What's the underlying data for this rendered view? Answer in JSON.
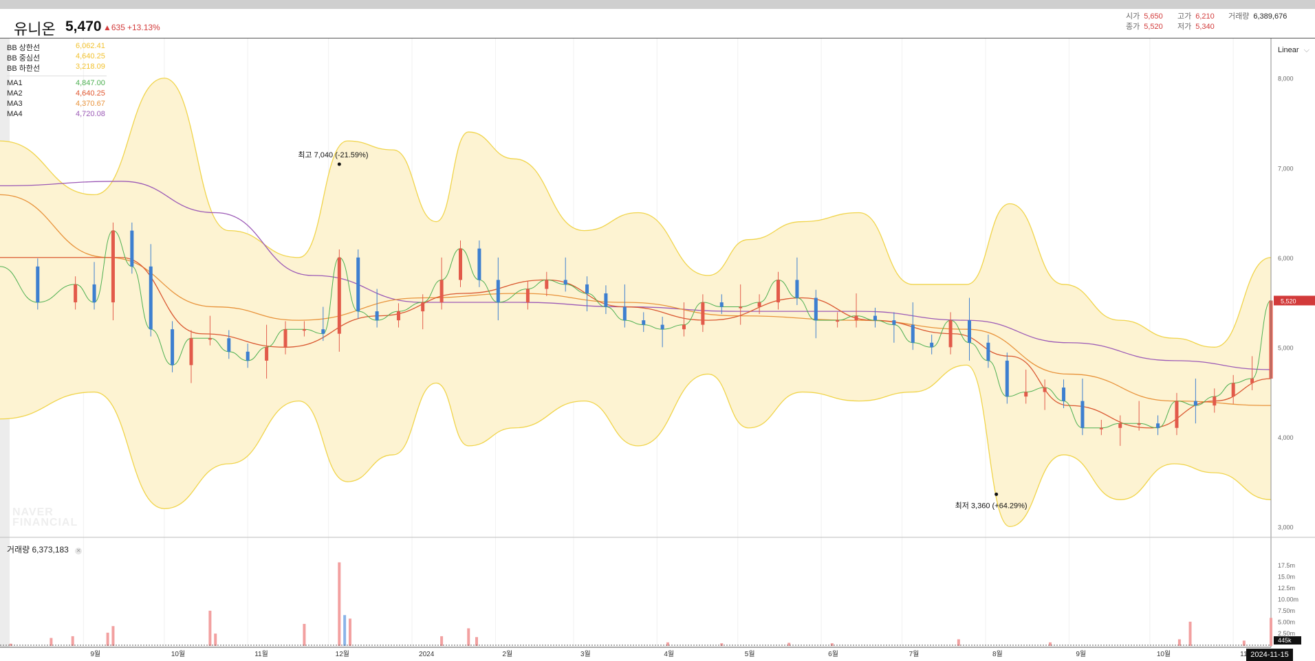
{
  "header": {
    "name": "유니온",
    "price": "5,470",
    "change": "▲635",
    "change_pct": "+13.13%",
    "open_label": "시가",
    "open": "5,650",
    "high_label": "고가",
    "high": "6,210",
    "volume_label": "거래량",
    "volume": "6,389,676",
    "close_label": "종가",
    "close": "5,520",
    "low_label": "저가",
    "low": "5,340"
  },
  "legend": {
    "bb": [
      {
        "label": "BB 상한선",
        "value": "6,062.41",
        "color": "#f2c12e"
      },
      {
        "label": "BB 중심선",
        "value": "4,640.25",
        "color": "#f2c12e"
      },
      {
        "label": "BB 하한선",
        "value": "3,218.09",
        "color": "#f2c12e"
      }
    ],
    "ma": [
      {
        "label": "MA1",
        "value": "4,847.00",
        "color": "#4caf50"
      },
      {
        "label": "MA2",
        "value": "4,640.25",
        "color": "#e0552e"
      },
      {
        "label": "MA3",
        "value": "4,370.67",
        "color": "#e8923a"
      },
      {
        "label": "MA4",
        "value": "4,720.08",
        "color": "#9b59b6"
      }
    ]
  },
  "scale_mode": "Linear",
  "volume_panel": {
    "label": "거래량",
    "value": "6,373,183"
  },
  "current_price_tag": "5,520",
  "current_volume_tag": "445k",
  "current_date_tag": "2024-11-15",
  "watermark": [
    "NAVER",
    "FINANCIAL"
  ],
  "colors": {
    "up": "#e25a4a",
    "down": "#3d7fd0",
    "band_fill": "#fdf3d2",
    "band_line": "#f0d44a",
    "ma1": "#4caf50",
    "ma2": "#d9562f",
    "ma3": "#e8923a",
    "ma4": "#9b59b6"
  },
  "chart_data": {
    "type": "candlestick",
    "y_axis": {
      "ticks": [
        "8,000",
        "7,000",
        "6,000",
        "5,000",
        "4,000",
        "3,000"
      ],
      "tick_values": [
        8000,
        7000,
        6000,
        5000,
        4000,
        3000
      ],
      "range": [
        2880,
        8450
      ]
    },
    "volume_axis": {
      "ticks": [
        "17.5m",
        "15.0m",
        "12.5m",
        "10.00m",
        "7.50m",
        "5.00m",
        "2.50m"
      ]
    },
    "x_labels": [
      "9월",
      "10월",
      "11월",
      "12월",
      "2024",
      "2월",
      "3월",
      "4월",
      "5월",
      "6월",
      "7월",
      "8월",
      "9월",
      "10월",
      "11월"
    ],
    "x_range": [
      "2023-08-01",
      "2024-11-15"
    ],
    "annotations": [
      {
        "text": "최고 7,040 (-21.59%)",
        "value": 7040,
        "date": "2023-12-05"
      },
      {
        "text": "최저 3,360 (+64.29%)",
        "value": 3360,
        "date": "2024-08-05"
      }
    ],
    "series": {
      "close": [
        [
          "2023-08-01",
          5900
        ],
        [
          "2023-08-15",
          5500
        ],
        [
          "2023-08-29",
          5700
        ],
        [
          "2023-09-05",
          5500
        ],
        [
          "2023-09-12",
          6300
        ],
        [
          "2023-09-19",
          5900
        ],
        [
          "2023-09-26",
          5200
        ],
        [
          "2023-10-04",
          4800
        ],
        [
          "2023-10-11",
          5100
        ],
        [
          "2023-10-18",
          5100
        ],
        [
          "2023-10-25",
          4950
        ],
        [
          "2023-11-01",
          4850
        ],
        [
          "2023-11-08",
          5000
        ],
        [
          "2023-11-15",
          5200
        ],
        [
          "2023-11-22",
          5200
        ],
        [
          "2023-11-29",
          5150
        ],
        [
          "2023-12-05",
          6000
        ],
        [
          "2023-12-12",
          5400
        ],
        [
          "2023-12-19",
          5300
        ],
        [
          "2023-12-27",
          5400
        ],
        [
          "2024-01-05",
          5500
        ],
        [
          "2024-01-12",
          5750
        ],
        [
          "2024-01-19",
          6100
        ],
        [
          "2024-01-26",
          5750
        ],
        [
          "2024-02-02",
          5500
        ],
        [
          "2024-02-13",
          5650
        ],
        [
          "2024-02-20",
          5750
        ],
        [
          "2024-02-27",
          5700
        ],
        [
          "2024-03-06",
          5600
        ],
        [
          "2024-03-13",
          5450
        ],
        [
          "2024-03-20",
          5300
        ],
        [
          "2024-03-27",
          5250
        ],
        [
          "2024-04-03",
          5200
        ],
        [
          "2024-04-11",
          5250
        ],
        [
          "2024-04-18",
          5500
        ],
        [
          "2024-04-25",
          5450
        ],
        [
          "2024-05-02",
          5450
        ],
        [
          "2024-05-09",
          5500
        ],
        [
          "2024-05-16",
          5750
        ],
        [
          "2024-05-23",
          5550
        ],
        [
          "2024-05-30",
          5300
        ],
        [
          "2024-06-07",
          5300
        ],
        [
          "2024-06-14",
          5350
        ],
        [
          "2024-06-21",
          5300
        ],
        [
          "2024-06-28",
          5250
        ],
        [
          "2024-07-05",
          5050
        ],
        [
          "2024-07-12",
          5000
        ],
        [
          "2024-07-19",
          5300
        ],
        [
          "2024-07-26",
          5050
        ],
        [
          "2024-08-02",
          4850
        ],
        [
          "2024-08-09",
          4450
        ],
        [
          "2024-08-16",
          4500
        ],
        [
          "2024-08-23",
          4550
        ],
        [
          "2024-08-30",
          4400
        ],
        [
          "2024-09-06",
          4100
        ],
        [
          "2024-09-13",
          4100
        ],
        [
          "2024-09-20",
          4150
        ],
        [
          "2024-09-27",
          4150
        ],
        [
          "2024-10-04",
          4100
        ],
        [
          "2024-10-11",
          4400
        ],
        [
          "2024-10-18",
          4350
        ],
        [
          "2024-10-25",
          4450
        ],
        [
          "2024-11-01",
          4600
        ],
        [
          "2024-11-08",
          4650
        ],
        [
          "2024-11-15",
          5520
        ]
      ],
      "bb_upper": [
        [
          "2023-08-01",
          7300
        ],
        [
          "2023-09-05",
          6700
        ],
        [
          "2023-10-01",
          8000
        ],
        [
          "2023-10-25",
          6300
        ],
        [
          "2023-11-20",
          6000
        ],
        [
          "2023-12-08",
          7300
        ],
        [
          "2023-12-25",
          7200
        ],
        [
          "2024-01-10",
          6400
        ],
        [
          "2024-01-22",
          7400
        ],
        [
          "2024-02-08",
          7100
        ],
        [
          "2024-03-05",
          6300
        ],
        [
          "2024-03-25",
          6500
        ],
        [
          "2024-04-20",
          5800
        ],
        [
          "2024-05-05",
          6200
        ],
        [
          "2024-05-25",
          6400
        ],
        [
          "2024-06-15",
          6500
        ],
        [
          "2024-07-05",
          5700
        ],
        [
          "2024-07-25",
          5700
        ],
        [
          "2024-08-10",
          6600
        ],
        [
          "2024-08-30",
          5700
        ],
        [
          "2024-09-20",
          5300
        ],
        [
          "2024-10-10",
          5100
        ],
        [
          "2024-10-25",
          5000
        ],
        [
          "2024-11-15",
          6000
        ]
      ],
      "bb_lower": [
        [
          "2023-08-01",
          4200
        ],
        [
          "2023-09-05",
          4500
        ],
        [
          "2023-10-01",
          3200
        ],
        [
          "2023-10-25",
          3700
        ],
        [
          "2023-11-20",
          4400
        ],
        [
          "2023-12-08",
          3500
        ],
        [
          "2023-12-25",
          3800
        ],
        [
          "2024-01-10",
          4600
        ],
        [
          "2024-01-22",
          3900
        ],
        [
          "2024-02-08",
          4100
        ],
        [
          "2024-03-05",
          4400
        ],
        [
          "2024-03-25",
          3900
        ],
        [
          "2024-04-20",
          4700
        ],
        [
          "2024-05-05",
          4100
        ],
        [
          "2024-05-25",
          4500
        ],
        [
          "2024-06-15",
          4400
        ],
        [
          "2024-07-05",
          4500
        ],
        [
          "2024-07-25",
          4800
        ],
        [
          "2024-08-10",
          3000
        ],
        [
          "2024-08-30",
          3800
        ],
        [
          "2024-09-20",
          3300
        ],
        [
          "2024-10-10",
          3700
        ],
        [
          "2024-10-25",
          3600
        ],
        [
          "2024-11-15",
          3300
        ]
      ],
      "ma4": [
        [
          "2023-08-01",
          6800
        ],
        [
          "2023-09-15",
          6850
        ],
        [
          "2023-10-20",
          6500
        ],
        [
          "2023-11-25",
          5800
        ],
        [
          "2024-01-05",
          5500
        ],
        [
          "2024-02-10",
          5500
        ],
        [
          "2024-03-20",
          5450
        ],
        [
          "2024-05-01",
          5400
        ],
        [
          "2024-06-15",
          5400
        ],
        [
          "2024-07-25",
          5300
        ],
        [
          "2024-09-01",
          5050
        ],
        [
          "2024-10-10",
          4850
        ],
        [
          "2024-11-15",
          4750
        ]
      ],
      "ma3": [
        [
          "2023-08-01",
          6700
        ],
        [
          "2023-09-10",
          6000
        ],
        [
          "2023-10-20",
          5450
        ],
        [
          "2023-11-20",
          5300
        ],
        [
          "2024-01-05",
          5550
        ],
        [
          "2024-02-10",
          5600
        ],
        [
          "2024-03-20",
          5500
        ],
        [
          "2024-05-01",
          5350
        ],
        [
          "2024-06-15",
          5300
        ],
        [
          "2024-07-25",
          5200
        ],
        [
          "2024-09-01",
          4700
        ],
        [
          "2024-10-10",
          4400
        ],
        [
          "2024-11-15",
          4350
        ]
      ],
      "ma2": [
        [
          "2023-08-01",
          6000
        ],
        [
          "2023-09-15",
          6000
        ],
        [
          "2023-10-15",
          5150
        ],
        [
          "2023-11-15",
          5000
        ],
        [
          "2023-12-20",
          5350
        ],
        [
          "2024-01-20",
          5600
        ],
        [
          "2024-02-20",
          5750
        ],
        [
          "2024-03-20",
          5450
        ],
        [
          "2024-04-20",
          5300
        ],
        [
          "2024-05-25",
          5550
        ],
        [
          "2024-06-20",
          5300
        ],
        [
          "2024-07-20",
          5150
        ],
        [
          "2024-08-10",
          4900
        ],
        [
          "2024-09-01",
          4350
        ],
        [
          "2024-10-01",
          4100
        ],
        [
          "2024-10-25",
          4400
        ],
        [
          "2024-11-15",
          4650
        ]
      ]
    },
    "volume_m": [
      [
        "2023-08-05",
        0.5
      ],
      [
        "2023-08-20",
        1.8
      ],
      [
        "2023-08-28",
        2.2
      ],
      [
        "2023-09-10",
        3.0
      ],
      [
        "2023-09-12",
        4.5
      ],
      [
        "2023-10-18",
        8.0
      ],
      [
        "2023-10-20",
        2.8
      ],
      [
        "2023-11-22",
        5.0
      ],
      [
        "2023-12-05",
        19.0
      ],
      [
        "2023-12-07",
        7.0
      ],
      [
        "2023-12-09",
        6.2
      ],
      [
        "2024-01-12",
        2.2
      ],
      [
        "2024-01-22",
        4.0
      ],
      [
        "2024-01-25",
        2.0
      ],
      [
        "2024-04-05",
        0.8
      ],
      [
        "2024-04-25",
        0.6
      ],
      [
        "2024-05-20",
        0.7
      ],
      [
        "2024-06-05",
        0.6
      ],
      [
        "2024-07-22",
        1.5
      ],
      [
        "2024-08-25",
        0.8
      ],
      [
        "2024-10-12",
        1.5
      ],
      [
        "2024-10-16",
        5.5
      ],
      [
        "2024-11-05",
        1.2
      ],
      [
        "2024-11-15",
        6.37
      ]
    ]
  }
}
